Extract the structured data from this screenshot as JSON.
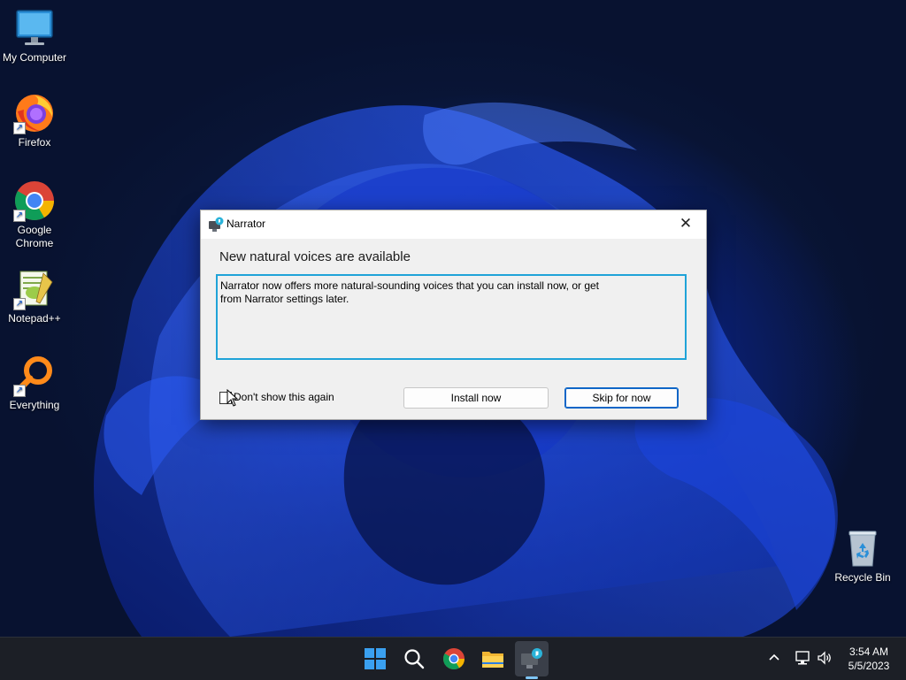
{
  "desktop": {
    "icons": [
      {
        "label": "My Computer"
      },
      {
        "label": "Firefox"
      },
      {
        "label": "Google Chrome"
      },
      {
        "label": "Notepad++"
      },
      {
        "label": "Everything"
      },
      {
        "label": "Recycle Bin"
      }
    ]
  },
  "dialog": {
    "title": "Narrator",
    "close_glyph": "✕",
    "heading": "New natural voices are available",
    "message": "Narrator now offers more natural-sounding voices that you can install now, or get from Narrator settings later.",
    "checkbox_label": "Don't show this again",
    "checkbox_checked": false,
    "install_label": "Install now",
    "skip_label": "Skip for now",
    "accent_color": "#1fa3d8"
  },
  "taskbar": {
    "items": [
      "windows-start-icon",
      "search-icon",
      "chrome-icon",
      "file-explorer-icon",
      "narrator-icon"
    ],
    "active_item": "narrator-icon",
    "tray_chevron": "^",
    "clock": {
      "time": "3:54 AM",
      "date": "5/5/2023"
    }
  }
}
